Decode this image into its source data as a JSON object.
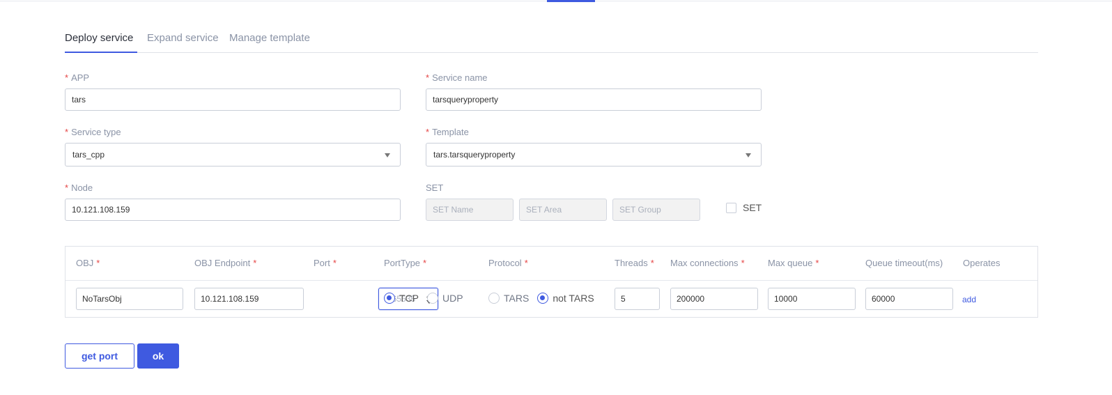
{
  "tabs": [
    {
      "label": "Deploy service",
      "active": true
    },
    {
      "label": "Expand service",
      "active": false
    },
    {
      "label": "Manage template",
      "active": false
    }
  ],
  "form": {
    "required_mark": "*",
    "app": {
      "label": "APP",
      "value": "tars"
    },
    "service_name": {
      "label": "Service name",
      "value": "tarsqueryproperty"
    },
    "service_type": {
      "label": "Service type",
      "value": "tars_cpp"
    },
    "template": {
      "label": "Template",
      "value": "tars.tarsqueryproperty"
    },
    "node": {
      "label": "Node",
      "value": "10.121.108.159"
    },
    "set": {
      "label": "SET",
      "name_placeholder": "SET Name",
      "area_placeholder": "SET Area",
      "group_placeholder": "SET Group",
      "checkbox_label": "SET",
      "checked": false
    }
  },
  "table": {
    "headers": {
      "obj": "OBJ",
      "endpoint": "OBJ Endpoint",
      "port": "Port",
      "port_type": "PortType",
      "protocol": "Protocol",
      "threads": "Threads",
      "max_connections": "Max connections",
      "max_queue": "Max queue",
      "queue_timeout": "Queue timeout(ms)",
      "operates": "Operates"
    },
    "row": {
      "obj": "NoTarsObj",
      "endpoint": "10.121.108.159",
      "port_placeholder": "0-65535",
      "port_type_options": [
        "TCP",
        "UDP"
      ],
      "port_type_selected": "TCP",
      "protocol_options": [
        "TARS",
        "not TARS"
      ],
      "protocol_selected": "not TARS",
      "threads": "5",
      "max_connections": "200000",
      "max_queue": "10000",
      "queue_timeout": "60000",
      "operate_label": "add"
    }
  },
  "actions": {
    "get_port": "get port",
    "ok": "ok"
  },
  "colors": {
    "accent": "#3f5ae0",
    "required": "#e54545",
    "label": "#8a93a6"
  }
}
